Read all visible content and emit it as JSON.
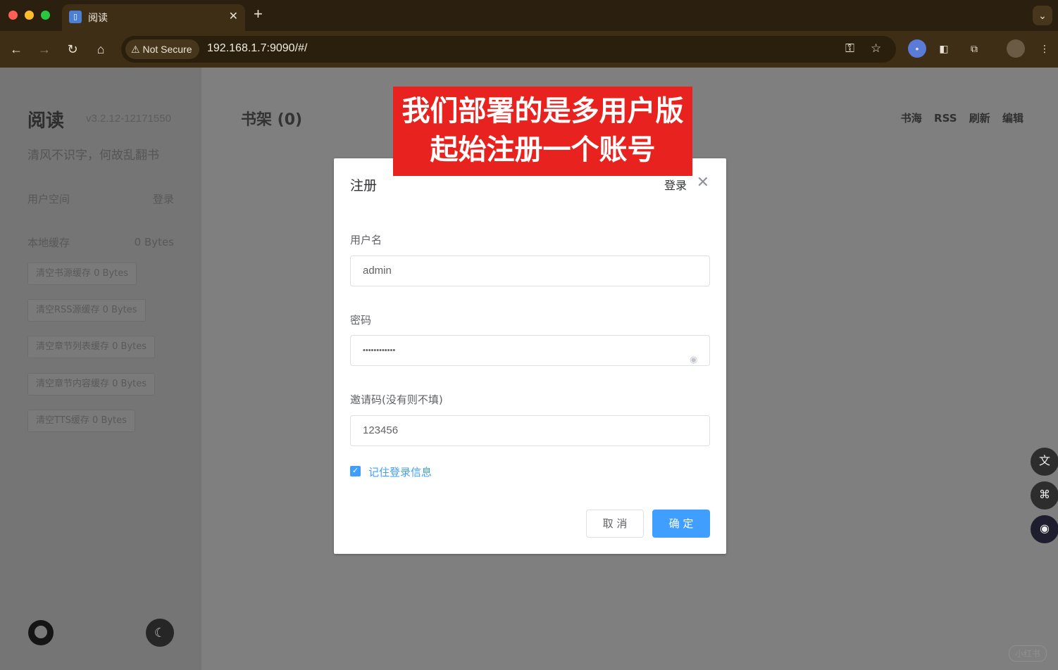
{
  "browser": {
    "tab_title": "阅读",
    "tab_favicon": "■",
    "tab_close": "✕",
    "new_tab": "+",
    "security_label": "Not Secure",
    "url": "192.168.1.7:9090/#/"
  },
  "sidebar": {
    "title": "阅读",
    "version": "v3.2.12-12171550",
    "slogan": "清风不识字，何故乱翻书",
    "user_space_label": "用户空间",
    "login_link": "登录",
    "local_cache_label": "本地缓存",
    "local_cache_value": "0 Bytes",
    "cache_buttons": [
      "清空书源缓存 0 Bytes",
      "清空RSS源缓存 0 Bytes",
      "清空章节列表缓存 0 Bytes",
      "清空章节内容缓存 0 Bytes",
      "清空TTS缓存 0 Bytes"
    ]
  },
  "main": {
    "shelf_title": "书架 (0)",
    "links": [
      "书海",
      "RSS",
      "刷新",
      "编辑"
    ]
  },
  "modal": {
    "title": "注册",
    "login_link": "登录",
    "username_label": "用户名",
    "username_value": "admin",
    "password_label": "密码",
    "password_value": "••••••••••••",
    "invite_label": "邀请码(没有则不填)",
    "invite_value": "123456",
    "remember_label": "记住登录信息",
    "remember_checked": true,
    "cancel_label": "取 消",
    "confirm_label": "确 定"
  },
  "caption": {
    "line1": "我们部署的是多用户版",
    "line2": "起始注册一个账号"
  },
  "watermark": "小红书",
  "colors": {
    "primary": "#409eff",
    "caption_bg": "#e8231f",
    "chrome_bg": "#3d2e15"
  }
}
